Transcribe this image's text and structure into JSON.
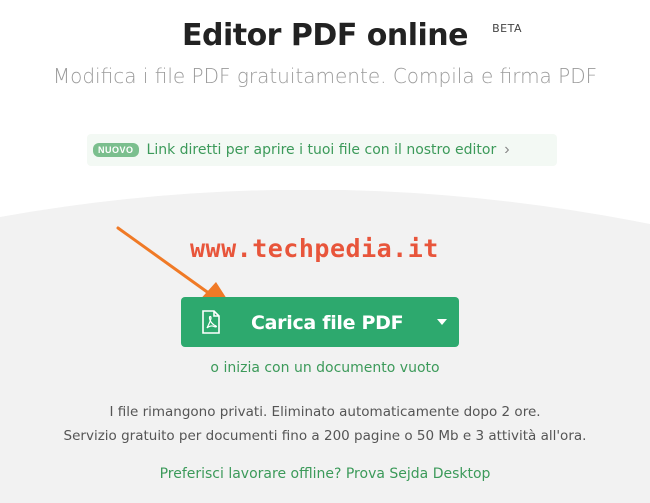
{
  "header": {
    "title": "Editor PDF online",
    "badge": "BETA",
    "subtitle": "Modifica i file PDF gratuitamente. Compila e firma PDF"
  },
  "banner": {
    "badge": "NUOVO",
    "text": "Link diretti per aprire i tuoi file con il nostro editor",
    "chevron": "›"
  },
  "watermark": "www.techpedia.it",
  "upload": {
    "label": "Carica file PDF"
  },
  "empty_doc_link": "o inizia con un documento vuoto",
  "info": {
    "line1": "I file rimangono privati. Eliminato automaticamente dopo 2 ore.",
    "line2": "Servizio gratuito per documenti fino a 200 pagine o 50 Mb e 3 attività all'ora."
  },
  "desktop_link": "Preferisci lavorare offline? Prova Sejda Desktop",
  "colors": {
    "accent": "#2da96e",
    "link": "#3c9a5a",
    "watermark": "#e8553b"
  }
}
